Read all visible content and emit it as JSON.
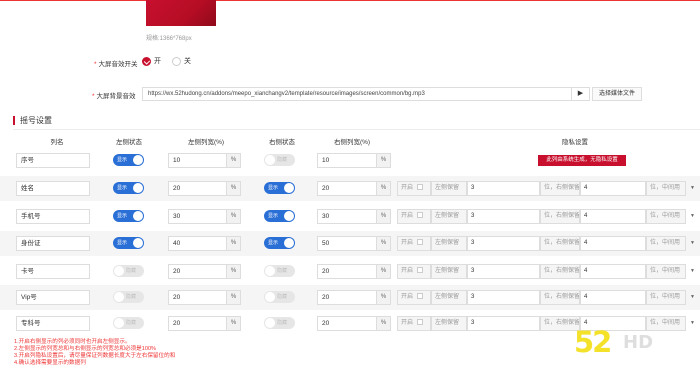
{
  "preview": {
    "size_hint": "规格:1366*768px"
  },
  "form": {
    "fx_switch": {
      "label": "大屏音效开关",
      "on_label": "开",
      "off_label": "关",
      "selected": "开"
    },
    "bg_music": {
      "label": "大屏背景音效",
      "url": "https://wx.52hudong.cn/addons/meepo_xianchangv2/template/resource/images/screen/common/bg.mp3",
      "play_icon": "play-icon",
      "choose_label": "选择媒体文件"
    }
  },
  "section_title": "摇号设置",
  "table": {
    "headers": [
      "列名",
      "左侧状态",
      "左侧列宽(%)",
      "右侧状态",
      "右侧列宽(%)",
      "隐私设置"
    ],
    "switch_on_label": "显示",
    "switch_off_label": "隐藏",
    "pct_label": "%",
    "privacy_labels": {
      "enable": "开启",
      "left_keep": "左侧保留",
      "right_keep": "位，右侧保留",
      "mid": "位，中间用"
    },
    "system_note": "此列由系统生成，无隐私设置",
    "rows": [
      {
        "name": "序号",
        "left_on": true,
        "left_width": "10",
        "right_on": false,
        "right_width": "10",
        "privacy": false
      },
      {
        "name": "姓名",
        "left_on": true,
        "left_width": "20",
        "right_on": true,
        "right_width": "20",
        "privacy": true,
        "left_keep": "3",
        "right_keep": "4"
      },
      {
        "name": "手机号",
        "left_on": true,
        "left_width": "30",
        "right_on": true,
        "right_width": "30",
        "privacy": true,
        "left_keep": "3",
        "right_keep": "4"
      },
      {
        "name": "身份证",
        "left_on": true,
        "left_width": "40",
        "right_on": true,
        "right_width": "50",
        "privacy": true,
        "left_keep": "3",
        "right_keep": "4"
      },
      {
        "name": "卡号",
        "left_on": false,
        "left_width": "20",
        "right_on": false,
        "right_width": "20",
        "privacy": true,
        "left_keep": "3",
        "right_keep": "4"
      },
      {
        "name": "Vip号",
        "left_on": false,
        "left_width": "20",
        "right_on": false,
        "right_width": "20",
        "privacy": true,
        "left_keep": "3",
        "right_keep": "4"
      },
      {
        "name": "专科号",
        "left_on": false,
        "left_width": "20",
        "right_on": false,
        "right_width": "20",
        "privacy": true,
        "left_keep": "3",
        "right_keep": "4"
      }
    ]
  },
  "notes": [
    "1.开启右侧显示的列必须同时也开启左侧显示。",
    "2.左侧显示的列宽总和与右侧显示的列宽总和必须是100%",
    "3.开启列隐私设置后，请尽量保证列数据长度大于左右保留位的和",
    "4.确认选择需要显示的数据列"
  ],
  "watermark": {
    "number": "52",
    "brand": "HD"
  },
  "colors": {
    "accent": "#c8102e",
    "switch_on": "#2a6fd6",
    "note_red": "#ee3333"
  }
}
